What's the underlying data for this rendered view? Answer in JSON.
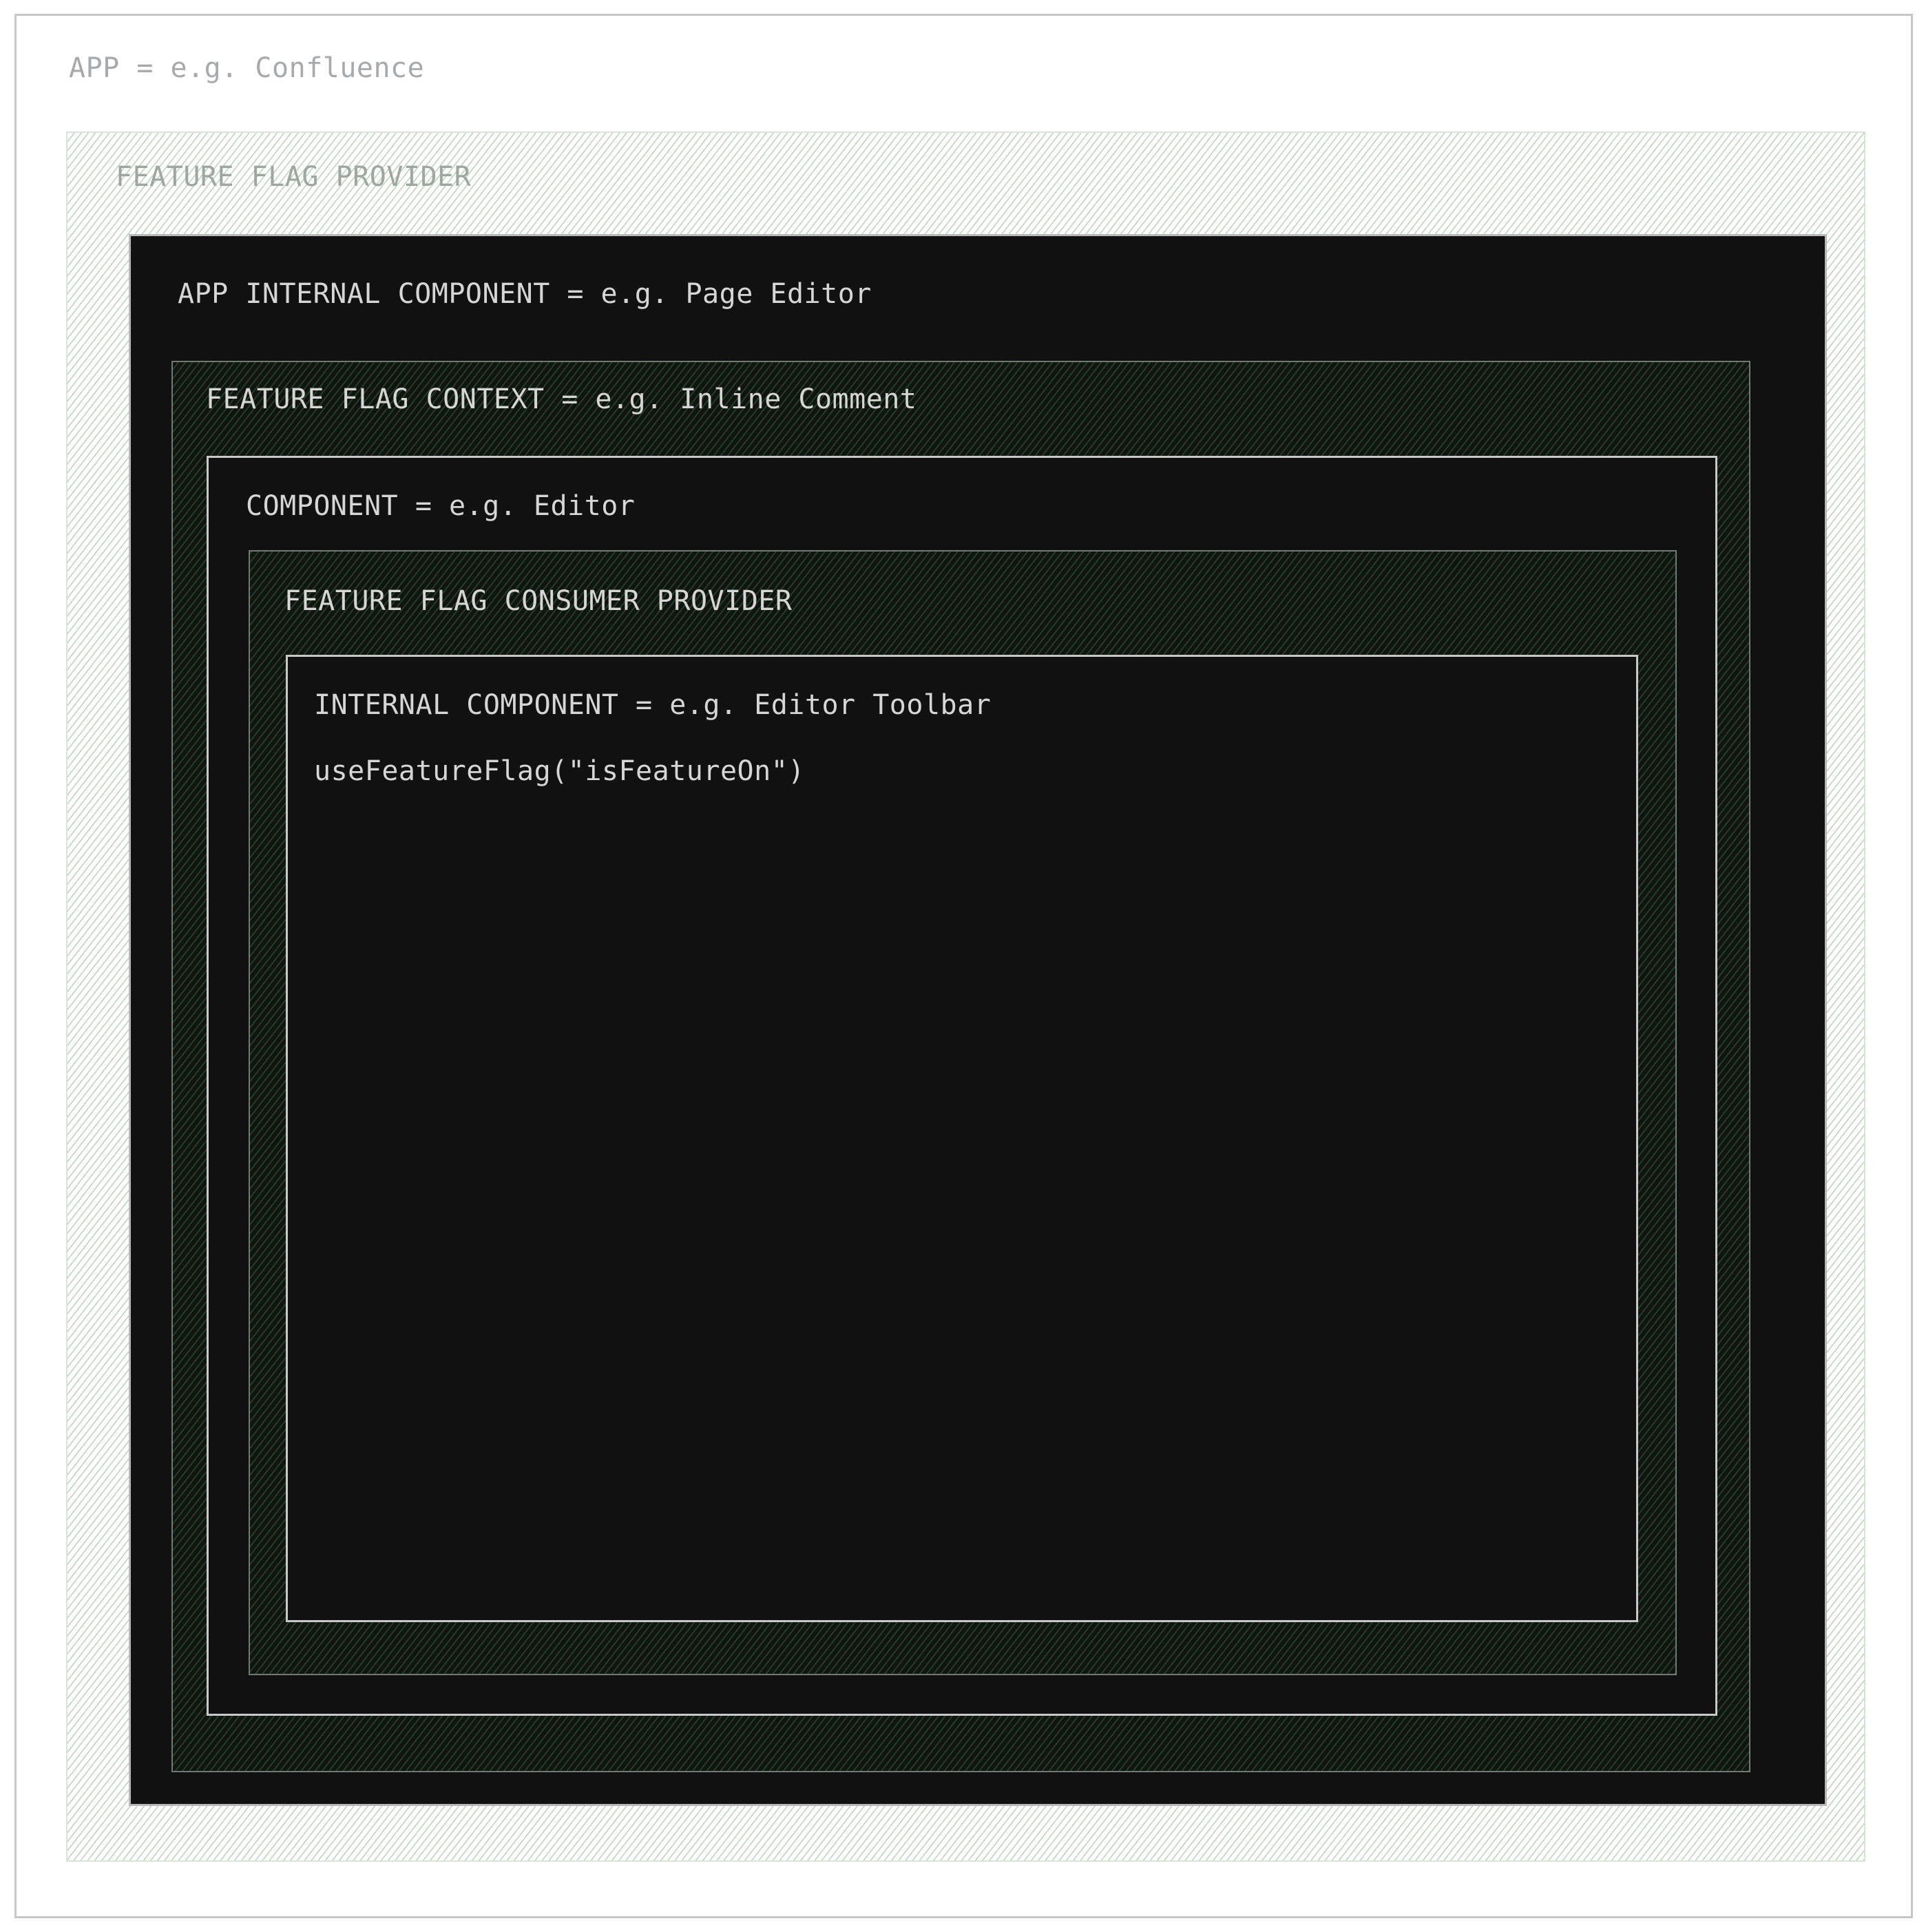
{
  "diagram": {
    "app": {
      "label": "APP = e.g. Confluence"
    },
    "feature_flag_provider": {
      "label": "FEATURE FLAG PROVIDER"
    },
    "app_internal_component": {
      "label": "APP INTERNAL COMPONENT = e.g. Page Editor"
    },
    "feature_flag_context": {
      "label": "FEATURE FLAG CONTEXT = e.g. Inline Comment"
    },
    "component": {
      "label": "COMPONENT = e.g. Editor"
    },
    "feature_flag_consumer_provider": {
      "label": "FEATURE FLAG CONSUMER PROVIDER"
    },
    "internal_component": {
      "label": "INTERNAL COMPONENT = e.g. Editor Toolbar",
      "code": "useFeatureFlag(\"isFeatureOn\")"
    }
  },
  "colors": {
    "dark_fill": "#111111",
    "light_hatch": "#78aa78",
    "dark_hatch": "#285a32",
    "text_light": "#d6d6d6",
    "text_muted": "#a7aaad"
  }
}
